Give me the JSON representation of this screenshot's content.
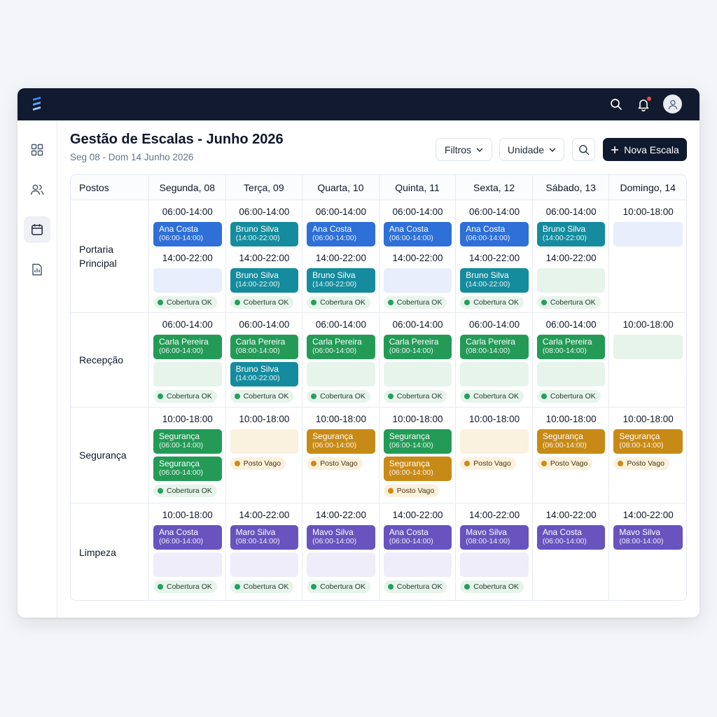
{
  "header": {
    "title": "Gestão de Escalas - Junho 2026",
    "subtitle": "Seg 08 - Dom 14 Junho 2026"
  },
  "toolbar": {
    "filters_label": "Filtros",
    "unit_label": "Unidade",
    "new_label": "Nova Escala"
  },
  "icons": {
    "logo": "stack-logo",
    "search": "search-icon",
    "notifications": "bell-icon",
    "user": "user-icon"
  },
  "sidebar": {
    "items": [
      "dashboard-icon",
      "users-icon",
      "calendar-icon",
      "report-icon"
    ],
    "active": "calendar-icon"
  },
  "colors": {
    "blue": "#2e6fd8",
    "teal": "#158c9e",
    "green": "#239b57",
    "gold": "#c88a16",
    "purple": "#6853bf",
    "ok": "#23a15a",
    "vacant": "#d08a12"
  },
  "table": {
    "corner": "Postos",
    "days": [
      "Segunda, 08",
      "Terça, 09",
      "Quarta, 10",
      "Quinta, 11",
      "Sexta, 12",
      "Sábado, 13",
      "Domingo, 14"
    ],
    "rows": [
      {
        "post": "Portaria Principal",
        "cells": [
          {
            "slots": [
              {
                "time": "06:00-14:00",
                "entries": [
                  {
                    "name": "Ana Costa",
                    "hours": "(06:00-14:00)",
                    "color": "blue"
                  }
                ]
              },
              {
                "time": "14:00-22:00",
                "entries": [
                  {
                    "empty": "blue"
                  }
                ]
              }
            ],
            "status": "Cobertura OK",
            "status_type": "ok"
          },
          {
            "slots": [
              {
                "time": "06:00-14:00",
                "entries": [
                  {
                    "name": "Bruno Silva",
                    "hours": "(14:00-22:00)",
                    "color": "teal"
                  }
                ]
              },
              {
                "time": "14:00-22:00",
                "entries": [
                  {
                    "name": "Bruno Silva",
                    "hours": "(14:00-22:00)",
                    "color": "teal"
                  }
                ]
              }
            ],
            "status": "Cobertura OK",
            "status_type": "ok"
          },
          {
            "slots": [
              {
                "time": "06:00-14:00",
                "entries": [
                  {
                    "name": "Ana Costa",
                    "hours": "(06:00-14:00)",
                    "color": "blue"
                  }
                ]
              },
              {
                "time": "14:00-22:00",
                "entries": [
                  {
                    "name": "Bruno Silva",
                    "hours": "(14:00-22:00)",
                    "color": "teal"
                  }
                ]
              }
            ],
            "status": "Cobertura OK",
            "status_type": "ok"
          },
          {
            "slots": [
              {
                "time": "06:00-14:00",
                "entries": [
                  {
                    "name": "Ana Costa",
                    "hours": "(06:00-14:00)",
                    "color": "blue"
                  }
                ]
              },
              {
                "time": "14:00-22:00",
                "entries": [
                  {
                    "empty": "blue"
                  }
                ]
              }
            ],
            "status": "Cobertura OK",
            "status_type": "ok"
          },
          {
            "slots": [
              {
                "time": "06:00-14:00",
                "entries": [
                  {
                    "name": "Ana Costa",
                    "hours": "(06:00-14:00)",
                    "color": "blue"
                  }
                ]
              },
              {
                "time": "14:00-22:00",
                "entries": [
                  {
                    "name": "Bruno Silva",
                    "hours": "(14:00-22:00)",
                    "color": "teal"
                  }
                ]
              }
            ],
            "status": "Cobertura OK",
            "status_type": "ok"
          },
          {
            "slots": [
              {
                "time": "06:00-14:00",
                "entries": [
                  {
                    "name": "Bruno Silva",
                    "hours": "(14:00-22:00)",
                    "color": "teal"
                  }
                ]
              },
              {
                "time": "14:00-22:00",
                "entries": [
                  {
                    "empty": "green"
                  }
                ]
              }
            ],
            "status": "Cobertura OK",
            "status_type": "ok"
          },
          {
            "slots": [
              {
                "time": "10:00-18:00",
                "entries": [
                  {
                    "empty": "blue"
                  }
                ]
              }
            ]
          }
        ]
      },
      {
        "post": "Recepção",
        "cells": [
          {
            "slots": [
              {
                "time": "06:00-14:00",
                "entries": [
                  {
                    "name": "Carla Pereira",
                    "hours": "(06:00-14:00)",
                    "color": "green"
                  },
                  {
                    "empty": "green"
                  }
                ]
              }
            ],
            "status": "Cobertura OK",
            "status_type": "ok"
          },
          {
            "slots": [
              {
                "time": "06:00-14:00",
                "entries": [
                  {
                    "name": "Carla Pereira",
                    "hours": "(08:00-14:00)",
                    "color": "green"
                  },
                  {
                    "name": "Bruno Silva",
                    "hours": "(14:00-22:00)",
                    "color": "teal"
                  }
                ]
              }
            ],
            "status": "Cobertura OK",
            "status_type": "ok"
          },
          {
            "slots": [
              {
                "time": "06:00-14:00",
                "entries": [
                  {
                    "name": "Carla Pereira",
                    "hours": "(06:00-14:00)",
                    "color": "green"
                  },
                  {
                    "empty": "green"
                  }
                ]
              }
            ],
            "status": "Cobertura OK",
            "status_type": "ok"
          },
          {
            "slots": [
              {
                "time": "06:00-14:00",
                "entries": [
                  {
                    "name": "Carla Pereira",
                    "hours": "(06:00-14:00)",
                    "color": "green"
                  },
                  {
                    "empty": "green"
                  }
                ]
              }
            ],
            "status": "Cobertura OK",
            "status_type": "ok"
          },
          {
            "slots": [
              {
                "time": "06:00-14:00",
                "entries": [
                  {
                    "name": "Carla Pereira",
                    "hours": "(08:00-14:00)",
                    "color": "green"
                  },
                  {
                    "empty": "green"
                  }
                ]
              }
            ],
            "status": "Cobertura OK",
            "status_type": "ok"
          },
          {
            "slots": [
              {
                "time": "06:00-14:00",
                "entries": [
                  {
                    "name": "Carla Pereira",
                    "hours": "(08:00-14:00)",
                    "color": "green"
                  },
                  {
                    "empty": "green"
                  }
                ]
              }
            ],
            "status": "Cobertura OK",
            "status_type": "ok"
          },
          {
            "slots": [
              {
                "time": "10:00-18:00",
                "entries": [
                  {
                    "empty": "green"
                  }
                ]
              }
            ]
          }
        ]
      },
      {
        "post": "Segurança",
        "cells": [
          {
            "slots": [
              {
                "time": "10:00-18:00",
                "entries": [
                  {
                    "name": "Segurança",
                    "hours": "(06:00-14:00)",
                    "color": "green"
                  },
                  {
                    "name": "Segurança",
                    "hours": "(06:00-14:00)",
                    "color": "green"
                  }
                ]
              }
            ],
            "status": "Cobertura OK",
            "status_type": "ok"
          },
          {
            "slots": [
              {
                "time": "10:00-18:00",
                "entries": [
                  {
                    "empty": "gold"
                  }
                ]
              }
            ],
            "status": "Posto Vago",
            "status_type": "vago"
          },
          {
            "slots": [
              {
                "time": "10:00-18:00",
                "entries": [
                  {
                    "name": "Segurança",
                    "hours": "(06:00-14:00)",
                    "color": "gold"
                  }
                ]
              }
            ],
            "status": "Posto Vago",
            "status_type": "vago"
          },
          {
            "slots": [
              {
                "time": "10:00-18:00",
                "entries": [
                  {
                    "name": "Segurança",
                    "hours": "(06:00-14:00)",
                    "color": "green"
                  },
                  {
                    "name": "Segurança",
                    "hours": "(06:00-14:00)",
                    "color": "gold"
                  }
                ]
              }
            ],
            "status": "Posto Vago",
            "status_type": "vago"
          },
          {
            "slots": [
              {
                "time": "10:00-18:00",
                "entries": [
                  {
                    "empty": "gold"
                  }
                ]
              }
            ],
            "status": "Posto Vago",
            "status_type": "vago"
          },
          {
            "slots": [
              {
                "time": "10:00-18:00",
                "entries": [
                  {
                    "name": "Segurança",
                    "hours": "(06:00-14:00)",
                    "color": "gold"
                  }
                ]
              }
            ],
            "status": "Posto Vago",
            "status_type": "vago"
          },
          {
            "slots": [
              {
                "time": "10:00-18:00",
                "entries": [
                  {
                    "name": "Segurança",
                    "hours": "(08:00-14:00)",
                    "color": "gold"
                  }
                ]
              }
            ],
            "status": "Posto Vago",
            "status_type": "vago"
          }
        ]
      },
      {
        "post": "Limpeza",
        "cells": [
          {
            "slots": [
              {
                "time": "10:00-18:00",
                "entries": [
                  {
                    "name": "Ana Costa",
                    "hours": "(06:00-14:00)",
                    "color": "purple"
                  },
                  {
                    "empty": "purple"
                  }
                ]
              }
            ],
            "status": "Cobertura OK",
            "status_type": "ok"
          },
          {
            "slots": [
              {
                "time": "14:00-22:00",
                "entries": [
                  {
                    "name": "Maro Silva",
                    "hours": "(08:00-14:00)",
                    "color": "purple"
                  },
                  {
                    "empty": "purple"
                  }
                ]
              }
            ],
            "status": "Cobertura OK",
            "status_type": "ok"
          },
          {
            "slots": [
              {
                "time": "14:00-22:00",
                "entries": [
                  {
                    "name": "Mavo Silva",
                    "hours": "(06:00-14:00)",
                    "color": "purple"
                  },
                  {
                    "empty": "purple"
                  }
                ]
              }
            ],
            "status": "Cobertura OK",
            "status_type": "ok"
          },
          {
            "slots": [
              {
                "time": "14:00-22:00",
                "entries": [
                  {
                    "name": "Ana Costa",
                    "hours": "(06:00-14:00)",
                    "color": "purple"
                  },
                  {
                    "empty": "purple"
                  }
                ]
              }
            ],
            "status": "Cobertura OK",
            "status_type": "ok"
          },
          {
            "slots": [
              {
                "time": "14:00-22:00",
                "entries": [
                  {
                    "name": "Mavo Silva",
                    "hours": "(08:00-14:00)",
                    "color": "purple"
                  },
                  {
                    "empty": "purple"
                  }
                ]
              }
            ],
            "status": "Cobertura OK",
            "status_type": "ok"
          },
          {
            "slots": [
              {
                "time": "14:00-22:00",
                "entries": [
                  {
                    "name": "Ana Costa",
                    "hours": "(06:00-14:00)",
                    "color": "purple"
                  }
                ]
              }
            ]
          },
          {
            "slots": [
              {
                "time": "14:00-22:00",
                "entries": [
                  {
                    "name": "Mavo Silva",
                    "hours": "(08:00-14:00)",
                    "color": "purple"
                  }
                ]
              }
            ]
          }
        ]
      }
    ]
  }
}
